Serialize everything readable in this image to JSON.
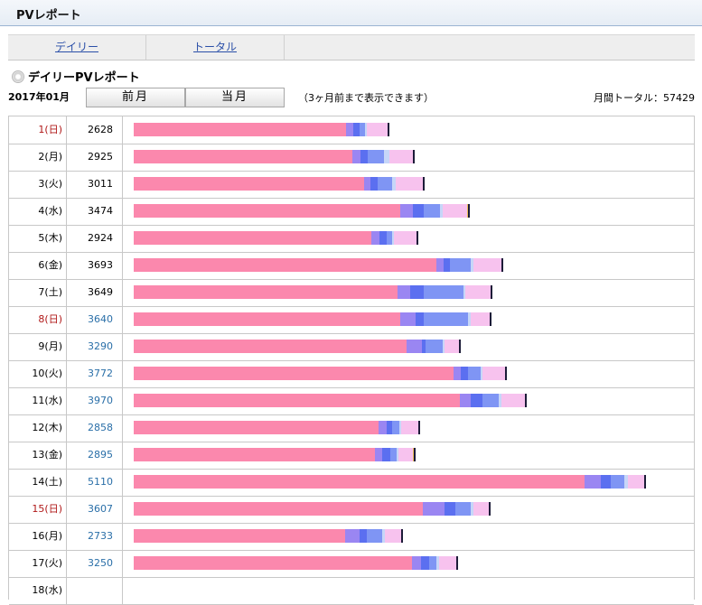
{
  "header": {
    "title": "PVレポート"
  },
  "tabs": [
    {
      "label": "デイリー"
    },
    {
      "label": "トータル"
    }
  ],
  "section_title": "デイリーPVレポート",
  "month": "2017年01月",
  "buttons": {
    "prev": "前月",
    "current": "当月"
  },
  "note": "（3ヶ月前まで表示できます）",
  "monthly_total": "月間トータル：57429",
  "colors": {
    "seg0": "#fb88ad",
    "seg1": "#9a86f2",
    "seg2": "#5b6ff0",
    "seg3": "#7f95f4",
    "seg4": "#c6d6f8",
    "seg5": "#f7c2ee",
    "seg6": "#f1c25a",
    "seg7": "#1c1c38",
    "holiday_text": "#b01818",
    "link_text": "#2a6fa8"
  },
  "rows": [
    {
      "day": "1(日)",
      "pv": "2628",
      "holiday": true,
      "link": false,
      "segments": [
        1540,
        55,
        45,
        40,
        15,
        150,
        0,
        12
      ]
    },
    {
      "day": "2(月)",
      "pv": "2925",
      "holiday": false,
      "link": false,
      "segments": [
        1590,
        55,
        55,
        120,
        40,
        170,
        0,
        15
      ]
    },
    {
      "day": "3(火)",
      "pv": "3011",
      "holiday": false,
      "link": false,
      "segments": [
        1670,
        50,
        55,
        100,
        25,
        200,
        0,
        15
      ]
    },
    {
      "day": "4(水)",
      "pv": "3474",
      "holiday": false,
      "link": false,
      "segments": [
        1935,
        90,
        80,
        120,
        20,
        175,
        5,
        12
      ]
    },
    {
      "day": "5(木)",
      "pv": "2924",
      "holiday": false,
      "link": false,
      "segments": [
        1725,
        60,
        55,
        40,
        10,
        165,
        0,
        12
      ]
    },
    {
      "day": "6(金)",
      "pv": "3693",
      "holiday": false,
      "link": false,
      "segments": [
        2195,
        55,
        45,
        150,
        25,
        200,
        0,
        12
      ]
    },
    {
      "day": "7(土)",
      "pv": "3649",
      "holiday": false,
      "link": false,
      "segments": [
        1915,
        95,
        95,
        290,
        15,
        180,
        0,
        12
      ]
    },
    {
      "day": "8(日)",
      "pv": "3640",
      "holiday": true,
      "link": true,
      "segments": [
        1935,
        110,
        60,
        320,
        20,
        140,
        0,
        15
      ]
    },
    {
      "day": "9(月)",
      "pv": "3290",
      "holiday": false,
      "link": true,
      "segments": [
        1980,
        115,
        25,
        125,
        15,
        100,
        0,
        12
      ]
    },
    {
      "day": "10(火)",
      "pv": "3772",
      "holiday": false,
      "link": true,
      "segments": [
        2320,
        55,
        50,
        95,
        15,
        165,
        0,
        12
      ]
    },
    {
      "day": "11(水)",
      "pv": "3970",
      "holiday": false,
      "link": true,
      "segments": [
        2370,
        75,
        85,
        120,
        20,
        170,
        0,
        20
      ]
    },
    {
      "day": "12(木)",
      "pv": "2858",
      "holiday": false,
      "link": true,
      "segments": [
        1780,
        55,
        40,
        55,
        15,
        125,
        0,
        12
      ]
    },
    {
      "day": "13(金)",
      "pv": "2895",
      "holiday": false,
      "link": true,
      "segments": [
        1750,
        55,
        60,
        45,
        10,
        110,
        5,
        12
      ]
    },
    {
      "day": "14(土)",
      "pv": "5110",
      "holiday": false,
      "link": true,
      "segments": [
        3275,
        115,
        75,
        100,
        25,
        120,
        0,
        12
      ]
    },
    {
      "day": "15(日)",
      "pv": "3607",
      "holiday": true,
      "link": true,
      "segments": [
        2100,
        155,
        80,
        115,
        20,
        110,
        0,
        12
      ]
    },
    {
      "day": "16(月)",
      "pv": "2733",
      "holiday": false,
      "link": true,
      "segments": [
        1535,
        105,
        50,
        115,
        20,
        115,
        0,
        10
      ]
    },
    {
      "day": "17(火)",
      "pv": "3250",
      "holiday": false,
      "link": true,
      "segments": [
        2020,
        65,
        60,
        55,
        15,
        125,
        0,
        12
      ]
    },
    {
      "day": "18(水)",
      "pv": "",
      "holiday": false,
      "link": false,
      "segments": []
    }
  ]
}
